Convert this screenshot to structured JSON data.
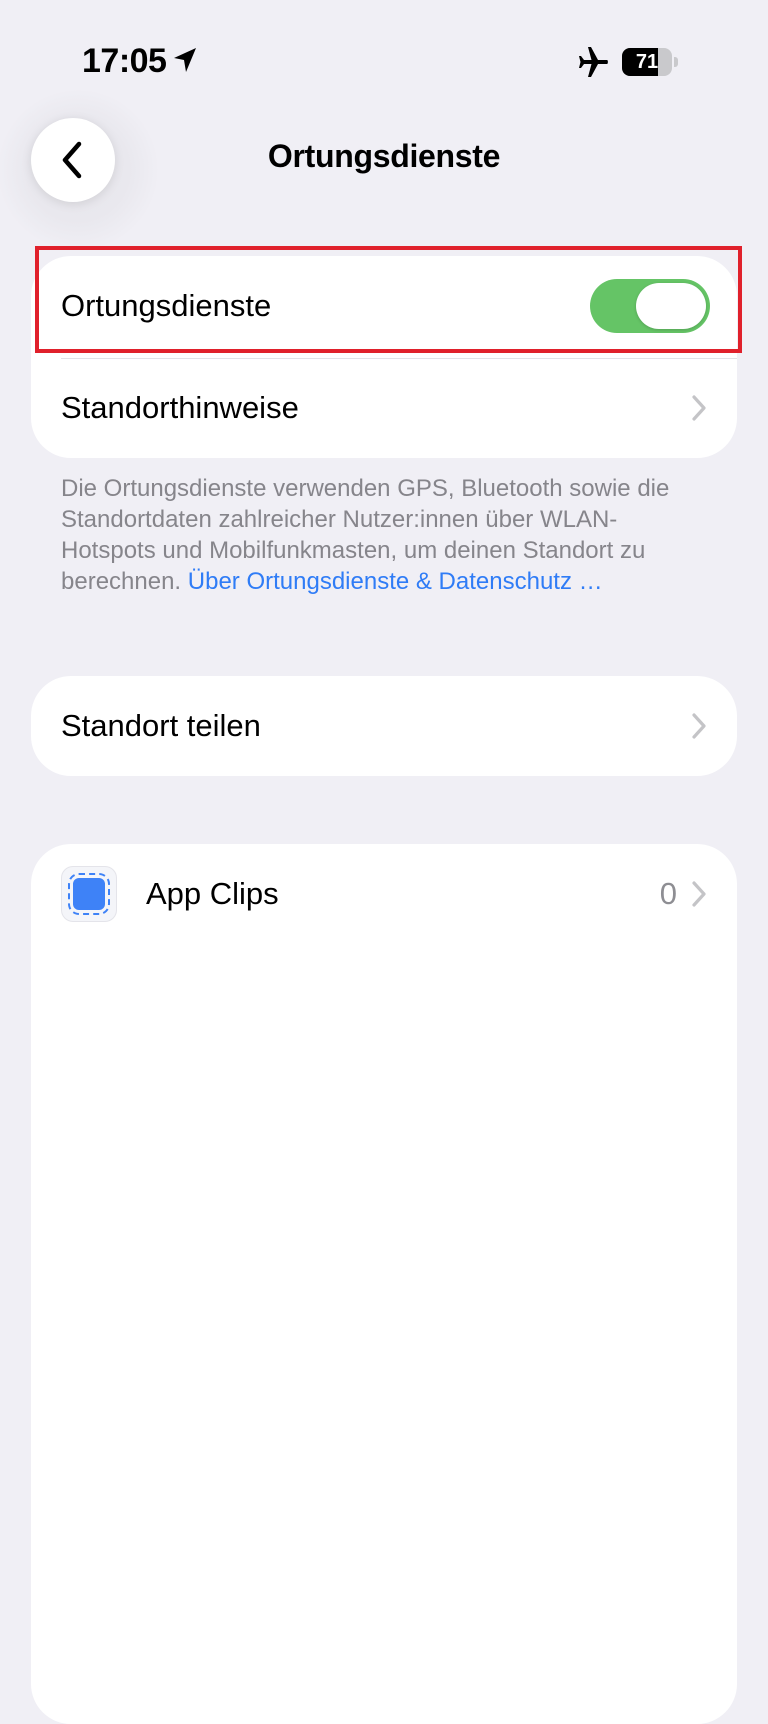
{
  "status_bar": {
    "time": "17:05",
    "location_icon": "location-arrow-icon",
    "airplane_icon": "airplane-icon",
    "battery_level": 71,
    "battery_text": "71"
  },
  "nav": {
    "back_icon": "chevron-left-icon",
    "title": "Ortungsdienste"
  },
  "location_section": {
    "toggle_label": "Ortungsdienste",
    "toggle_on": true,
    "toggle_color": "#65c466",
    "hints_label": "Standorthinweise"
  },
  "footnote": {
    "text": "Die Ortungsdienste verwenden GPS, Bluetooth sowie die Standortdaten zahlreicher Nutzer:innen über WLAN-Hotspots und Mobilfunkmasten, um deinen Standort zu berechnen.",
    "link": "Über Ortungsdienste & Daten­schutz …",
    "link_color": "#2f7cf6"
  },
  "share_section": {
    "label": "Standort teilen"
  },
  "apps_section": {
    "app_clips": {
      "label": "App Clips",
      "count": "0",
      "icon": "app-clip-icon"
    }
  },
  "highlight_color": "#e0202b"
}
